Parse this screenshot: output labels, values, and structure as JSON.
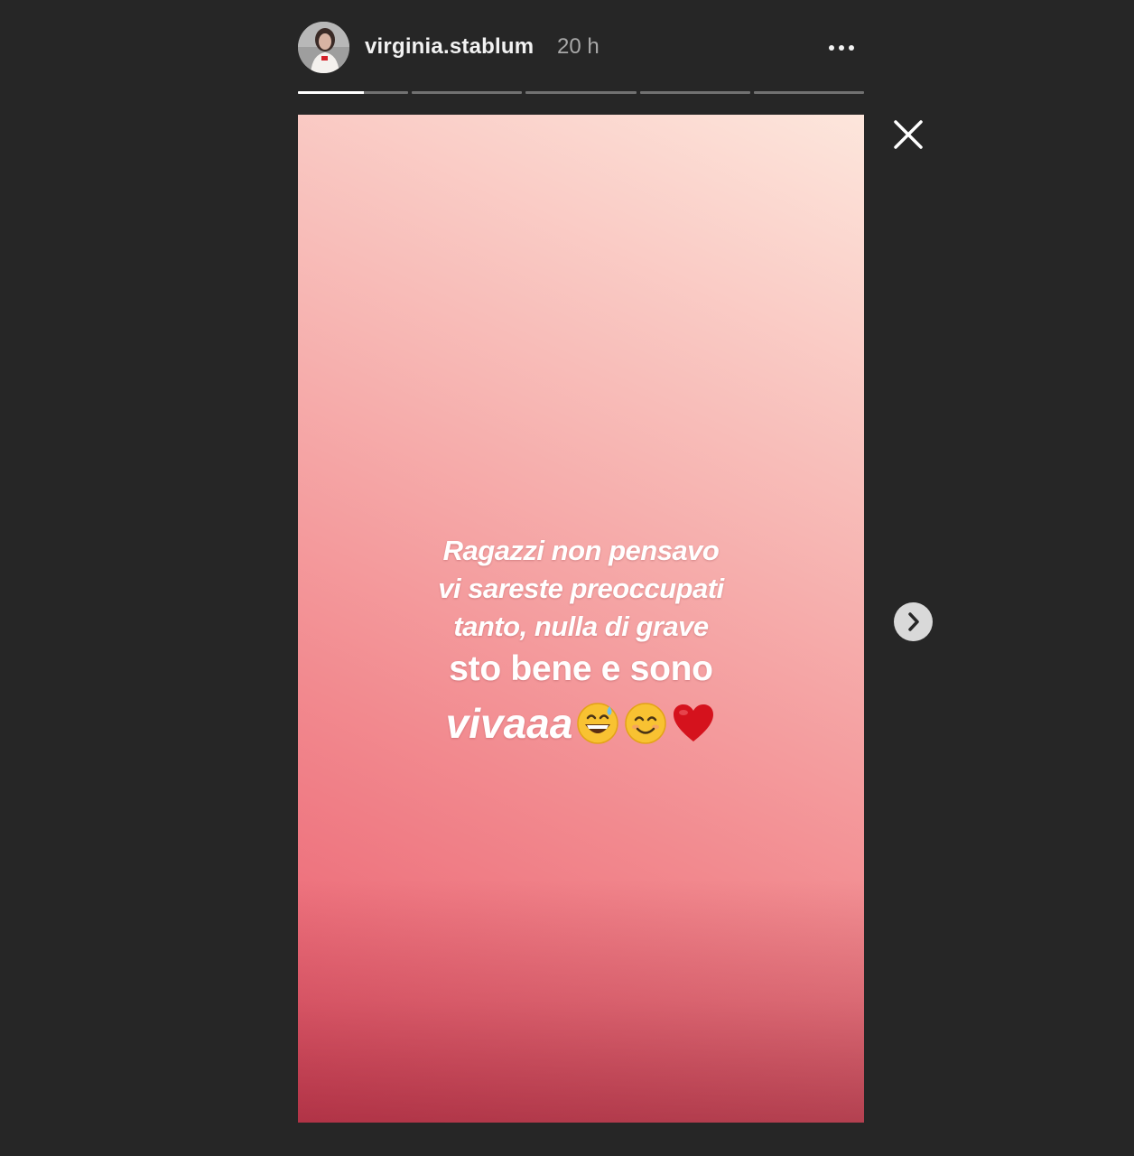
{
  "header": {
    "username": "virginia.stablum",
    "timestamp": "20 h",
    "more_icon": "more-horizontal-icon"
  },
  "progress": {
    "segments": 5,
    "current_index": 0,
    "current_fill_fraction": 0.6
  },
  "story": {
    "lines": [
      "Ragazzi non pensavo",
      "vi sareste preoccupati",
      "tanto, nulla di grave",
      "sto bene e sono",
      "vivaaa"
    ],
    "emojis": [
      "grinning-sweat-emoji",
      "smiling-face-emoji",
      "red-heart-emoji"
    ],
    "gradient_colors": [
      "#e9596b",
      "#f28a8f",
      "#f7b6b3",
      "#fde6dc"
    ]
  },
  "controls": {
    "close_icon": "close-icon",
    "next_icon": "chevron-right-icon"
  }
}
